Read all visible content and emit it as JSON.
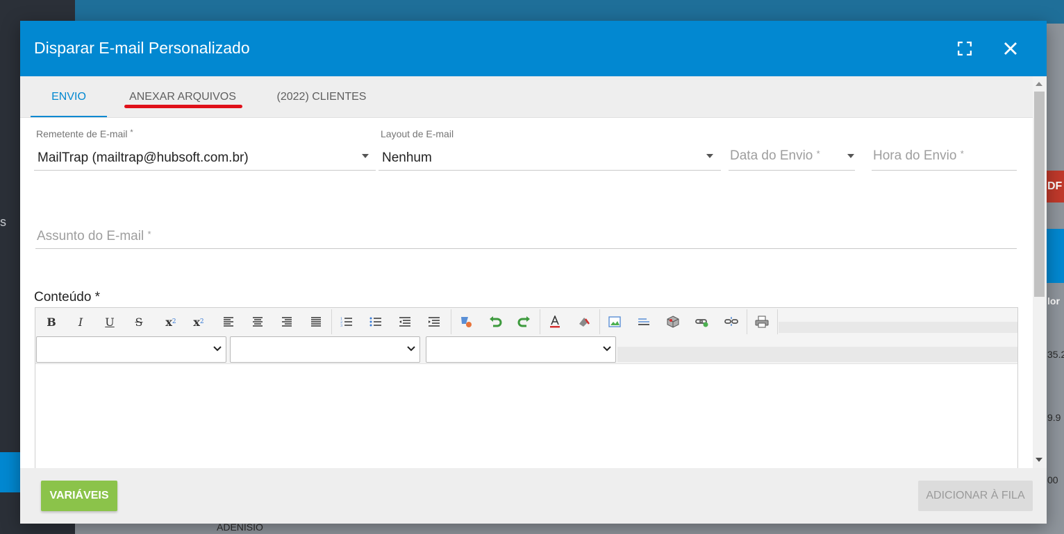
{
  "background": {
    "sidebar_fragment": "s",
    "badge_fragment": "DF",
    "column_fragment": "lor",
    "cells": [
      "35.2",
      "9.9",
      "00"
    ],
    "row_name": "ADENISIO"
  },
  "modal": {
    "title": "Disparar E-mail Personalizado",
    "fullscreen_icon": "fullscreen-icon",
    "close_icon": "close-icon",
    "accent_color": "#0288d1"
  },
  "tabs": [
    {
      "label": "ENVIO",
      "active": true
    },
    {
      "label": "ANEXAR ARQUIVOS",
      "active": false,
      "annotated": true
    },
    {
      "label": "(2022) CLIENTES",
      "active": false
    }
  ],
  "form": {
    "remetente": {
      "label": "Remetente de E-mail",
      "required_mark": "*",
      "value": "MailTrap (mailtrap@hubsoft.com.br)"
    },
    "layout": {
      "label": "Layout de E-mail",
      "value": "Nenhum"
    },
    "data_envio": {
      "placeholder": "Data do Envio",
      "required_mark": "*"
    },
    "hora_envio": {
      "placeholder": "Hora do Envio",
      "required_mark": "*"
    },
    "assunto": {
      "placeholder": "Assunto do E-mail",
      "required_mark": "*"
    }
  },
  "editor": {
    "label": "Conteúdo *",
    "toolbar": {
      "bold": "B",
      "italic": "I",
      "underline": "U",
      "strike": "S",
      "subscript": "x",
      "superscript": "x"
    },
    "selects": [
      "",
      "",
      ""
    ]
  },
  "footer": {
    "variables_button": "VARIÁVEIS",
    "add_queue_button": "ADICIONAR À FILA",
    "variables_color": "#8bc34a"
  }
}
